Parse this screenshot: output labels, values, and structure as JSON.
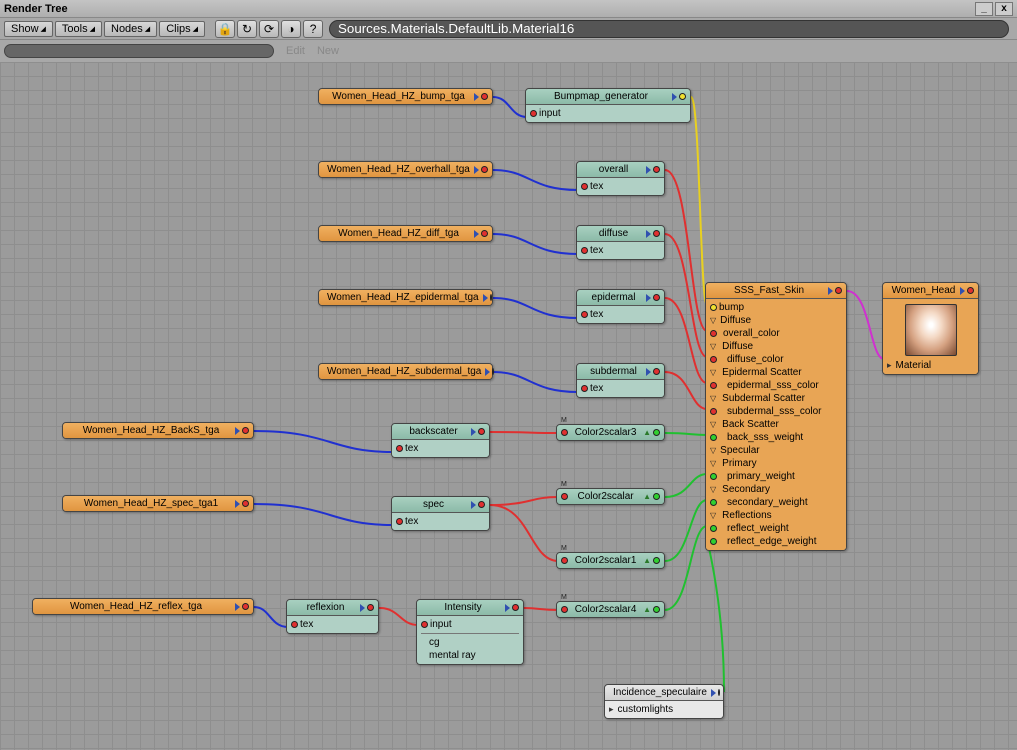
{
  "window": {
    "title": "Render Tree"
  },
  "menus": {
    "show": "Show",
    "tools": "Tools",
    "nodes": "Nodes",
    "clips": "Clips"
  },
  "path": "Sources.Materials.DefaultLib.Material16",
  "buttons": {
    "edit": "Edit",
    "new": "New"
  },
  "tex_nodes": {
    "bump": "Women_Head_HZ_bump_tga",
    "overhall": "Women_Head_HZ_overhall_tga",
    "diff": "Women_Head_HZ_diff_tga",
    "epidermal": "Women_Head_HZ_epidermal_tga",
    "subdermal": "Women_Head_HZ_subdermal_tga",
    "backs": "Women_Head_HZ_BackS_tga",
    "spec": "Women_Head_HZ_spec_tga1",
    "reflex": "Women_Head_HZ_reflex_tga"
  },
  "shader_nodes": {
    "bumpmap_gen": "Bumpmap_generator",
    "overall": "overall",
    "diffuse": "diffuse",
    "epidermal": "epidermal",
    "subdermal": "subdermal",
    "backscater": "backscater",
    "spec": "spec",
    "reflexion": "reflexion",
    "intensity": "Intensity",
    "c2s": "Color2scalar",
    "c2s1": "Color2scalar1",
    "c2s3": "Color2scalar3",
    "c2s4": "Color2scalar4",
    "incidence": "Incidence_speculaire"
  },
  "ports": {
    "input": "input",
    "tex": "tex",
    "cg": "cg",
    "mental_ray": "mental ray",
    "customlights": "customlights",
    "material": "Material"
  },
  "sss": {
    "title": "SSS_Fast_Skin",
    "bump": "bump",
    "diffuse_hdr": "Diffuse",
    "overall_color": "overall_color",
    "diffuse": "Diffuse",
    "diffuse_color": "diffuse_color",
    "epi_hdr": "Epidermal Scatter",
    "epi_color": "epidermal_sss_color",
    "sub_hdr": "Subdermal Scatter",
    "sub_color": "subdermal_sss_color",
    "back_hdr": "Back Scatter",
    "back_weight": "back_sss_weight",
    "spec_hdr": "Specular",
    "primary_hdr": "Primary",
    "primary_weight": "primary_weight",
    "secondary_hdr": "Secondary",
    "secondary_weight": "secondary_weight",
    "refl_hdr": "Reflections",
    "reflect_weight": "reflect_weight",
    "reflect_edge_weight": "reflect_edge_weight"
  },
  "material": {
    "title": "Women_Head"
  }
}
